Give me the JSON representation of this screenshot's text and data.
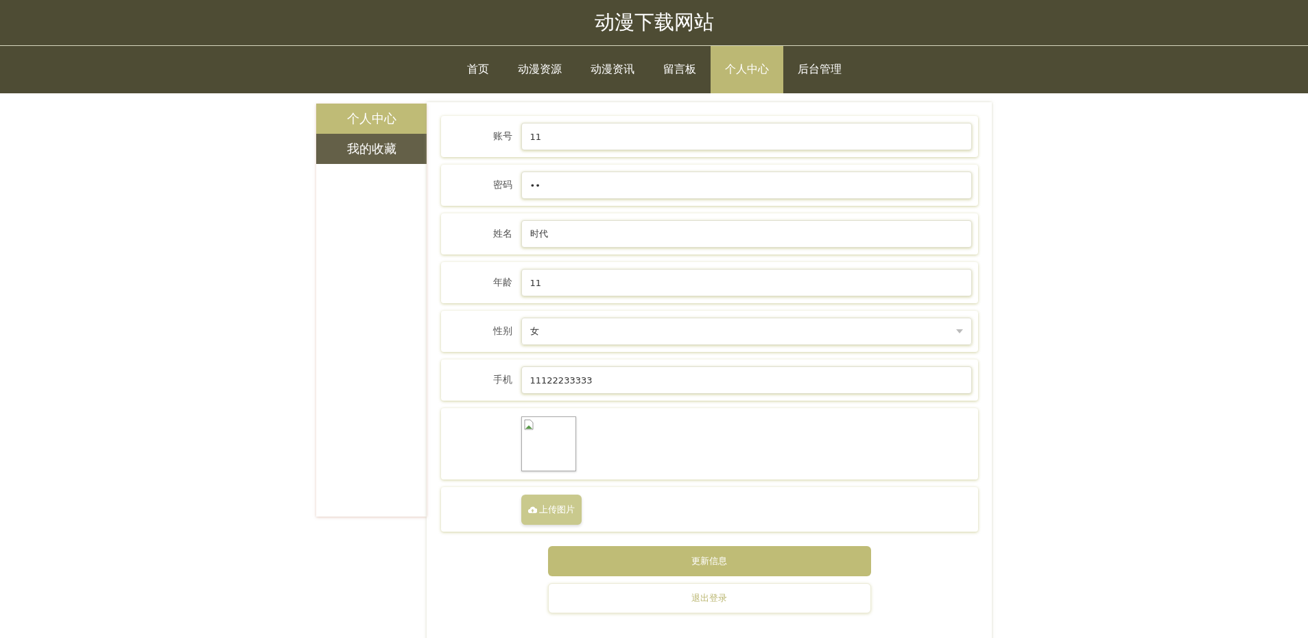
{
  "site_title": "动漫下载网站",
  "nav": [
    {
      "label": "首页",
      "selected": false
    },
    {
      "label": "动漫资源",
      "selected": false
    },
    {
      "label": "动漫资讯",
      "selected": false
    },
    {
      "label": "留言板",
      "selected": false
    },
    {
      "label": "个人中心",
      "selected": true
    },
    {
      "label": "后台管理",
      "selected": false
    }
  ],
  "sidebar": [
    {
      "label": "个人中心",
      "selected": true
    },
    {
      "label": "我的收藏",
      "selected": false
    }
  ],
  "form": [
    {
      "kind": "text",
      "label": "账号",
      "value": "11"
    },
    {
      "kind": "text",
      "label": "密码",
      "value": "••"
    },
    {
      "kind": "text",
      "label": "姓名",
      "value": "时代"
    },
    {
      "kind": "text",
      "label": "年龄",
      "value": "11"
    },
    {
      "kind": "select",
      "label": "性别",
      "value": "女"
    },
    {
      "kind": "text",
      "label": "手机",
      "value": "11122233333"
    }
  ],
  "upload_button": "上传图片",
  "buttons": [
    {
      "kind": "primary",
      "label": "更新信息"
    },
    {
      "kind": "secondary",
      "label": "退出登录"
    }
  ]
}
